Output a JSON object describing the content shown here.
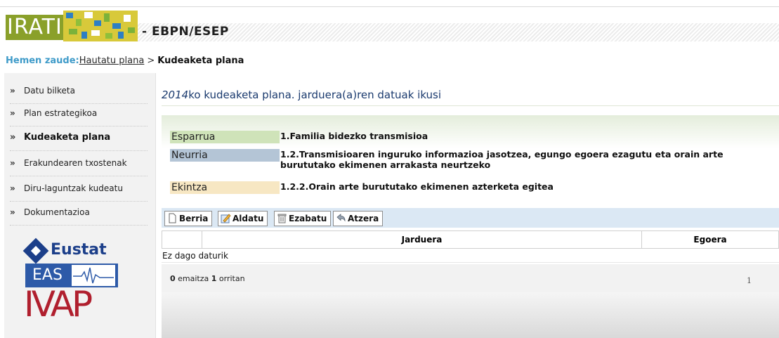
{
  "header": {
    "logo_text": "IRATI",
    "title": "- EBPN/ESEP"
  },
  "breadcrumb": {
    "label": "Hemen zaude:",
    "link": "Hautatu plana",
    "separator": ">",
    "current": "Kudeaketa plana"
  },
  "sidebar": {
    "items": [
      {
        "label": "Datu bilketa"
      },
      {
        "label": "Plan estrategikoa"
      },
      {
        "label": "Kudeaketa plana"
      },
      {
        "label": "Erakundearen txostenak"
      },
      {
        "label": "Diru-laguntzak kudeatu"
      },
      {
        "label": "Dokumentazioa"
      }
    ],
    "logos": {
      "eustat": "Eustat",
      "eas": "EAS",
      "ivap": "IVAP"
    }
  },
  "main": {
    "title_year": "2014",
    "title_rest": "ko kudeaketa plana. jarduera(a)ren datuak ikusi",
    "info": [
      {
        "key": "Esparrua",
        "value": "1.Familia bidezko transmisioa"
      },
      {
        "key": "Neurria",
        "value": "1.2.Transmisioaren inguruko informazioa jasotzea, egungo egoera ezagutu eta orain arte burututako ekimenen arrakasta neurtzeko"
      },
      {
        "key": "Ekintza",
        "value": "1.2.2.Orain arte burututako ekimenen azterketa egitea"
      }
    ],
    "toolbar": {
      "new": "Berria",
      "edit": "Aldatu",
      "delete": "Ezabatu",
      "back": "Atzera"
    },
    "table": {
      "columns": [
        "Jarduera",
        "Egoera"
      ],
      "empty": "Ez dago daturik"
    },
    "pager": {
      "results": "0",
      "results_label": "emaitza",
      "pages": "1",
      "pages_label": "orritan",
      "current_page": "1"
    }
  },
  "colors": {
    "breadcrumb_label": "#3f9bc9",
    "title": "#1a3a6e",
    "esparrua_bg": "#cfe3b9",
    "neurria_bg": "#b4c5d6",
    "ekintza_bg": "#f7e7c3",
    "toolbar_bg": "#dbe8f4"
  }
}
